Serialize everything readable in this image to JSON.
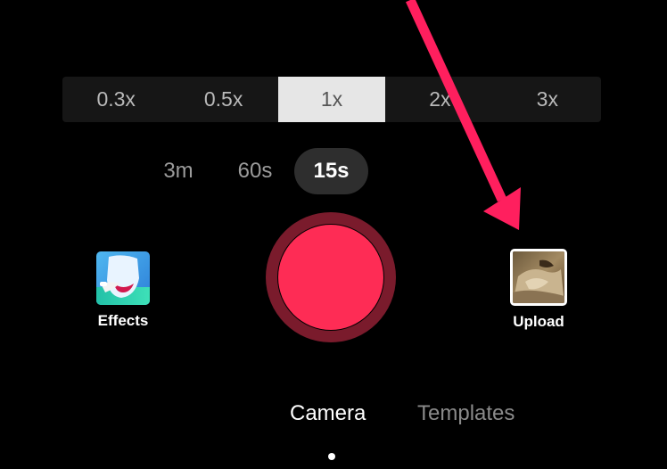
{
  "zoom": {
    "options": [
      "0.3x",
      "0.5x",
      "1x",
      "2x",
      "3x"
    ],
    "selected": "1x"
  },
  "duration": {
    "options": [
      "3m",
      "60s",
      "15s"
    ],
    "selected": "15s"
  },
  "tools": {
    "effects_label": "Effects",
    "effects_icon": "effects-face-icon",
    "upload_label": "Upload",
    "upload_icon": "gallery-thumbnail"
  },
  "record": {
    "icon": "record-button",
    "color": "#fe2c55",
    "ring_color": "#7a1b2c"
  },
  "modes": {
    "camera_label": "Camera",
    "templates_label": "Templates",
    "selected": "Camera"
  },
  "annotation": {
    "icon": "pointer-arrow",
    "color": "#ff1f5e"
  }
}
